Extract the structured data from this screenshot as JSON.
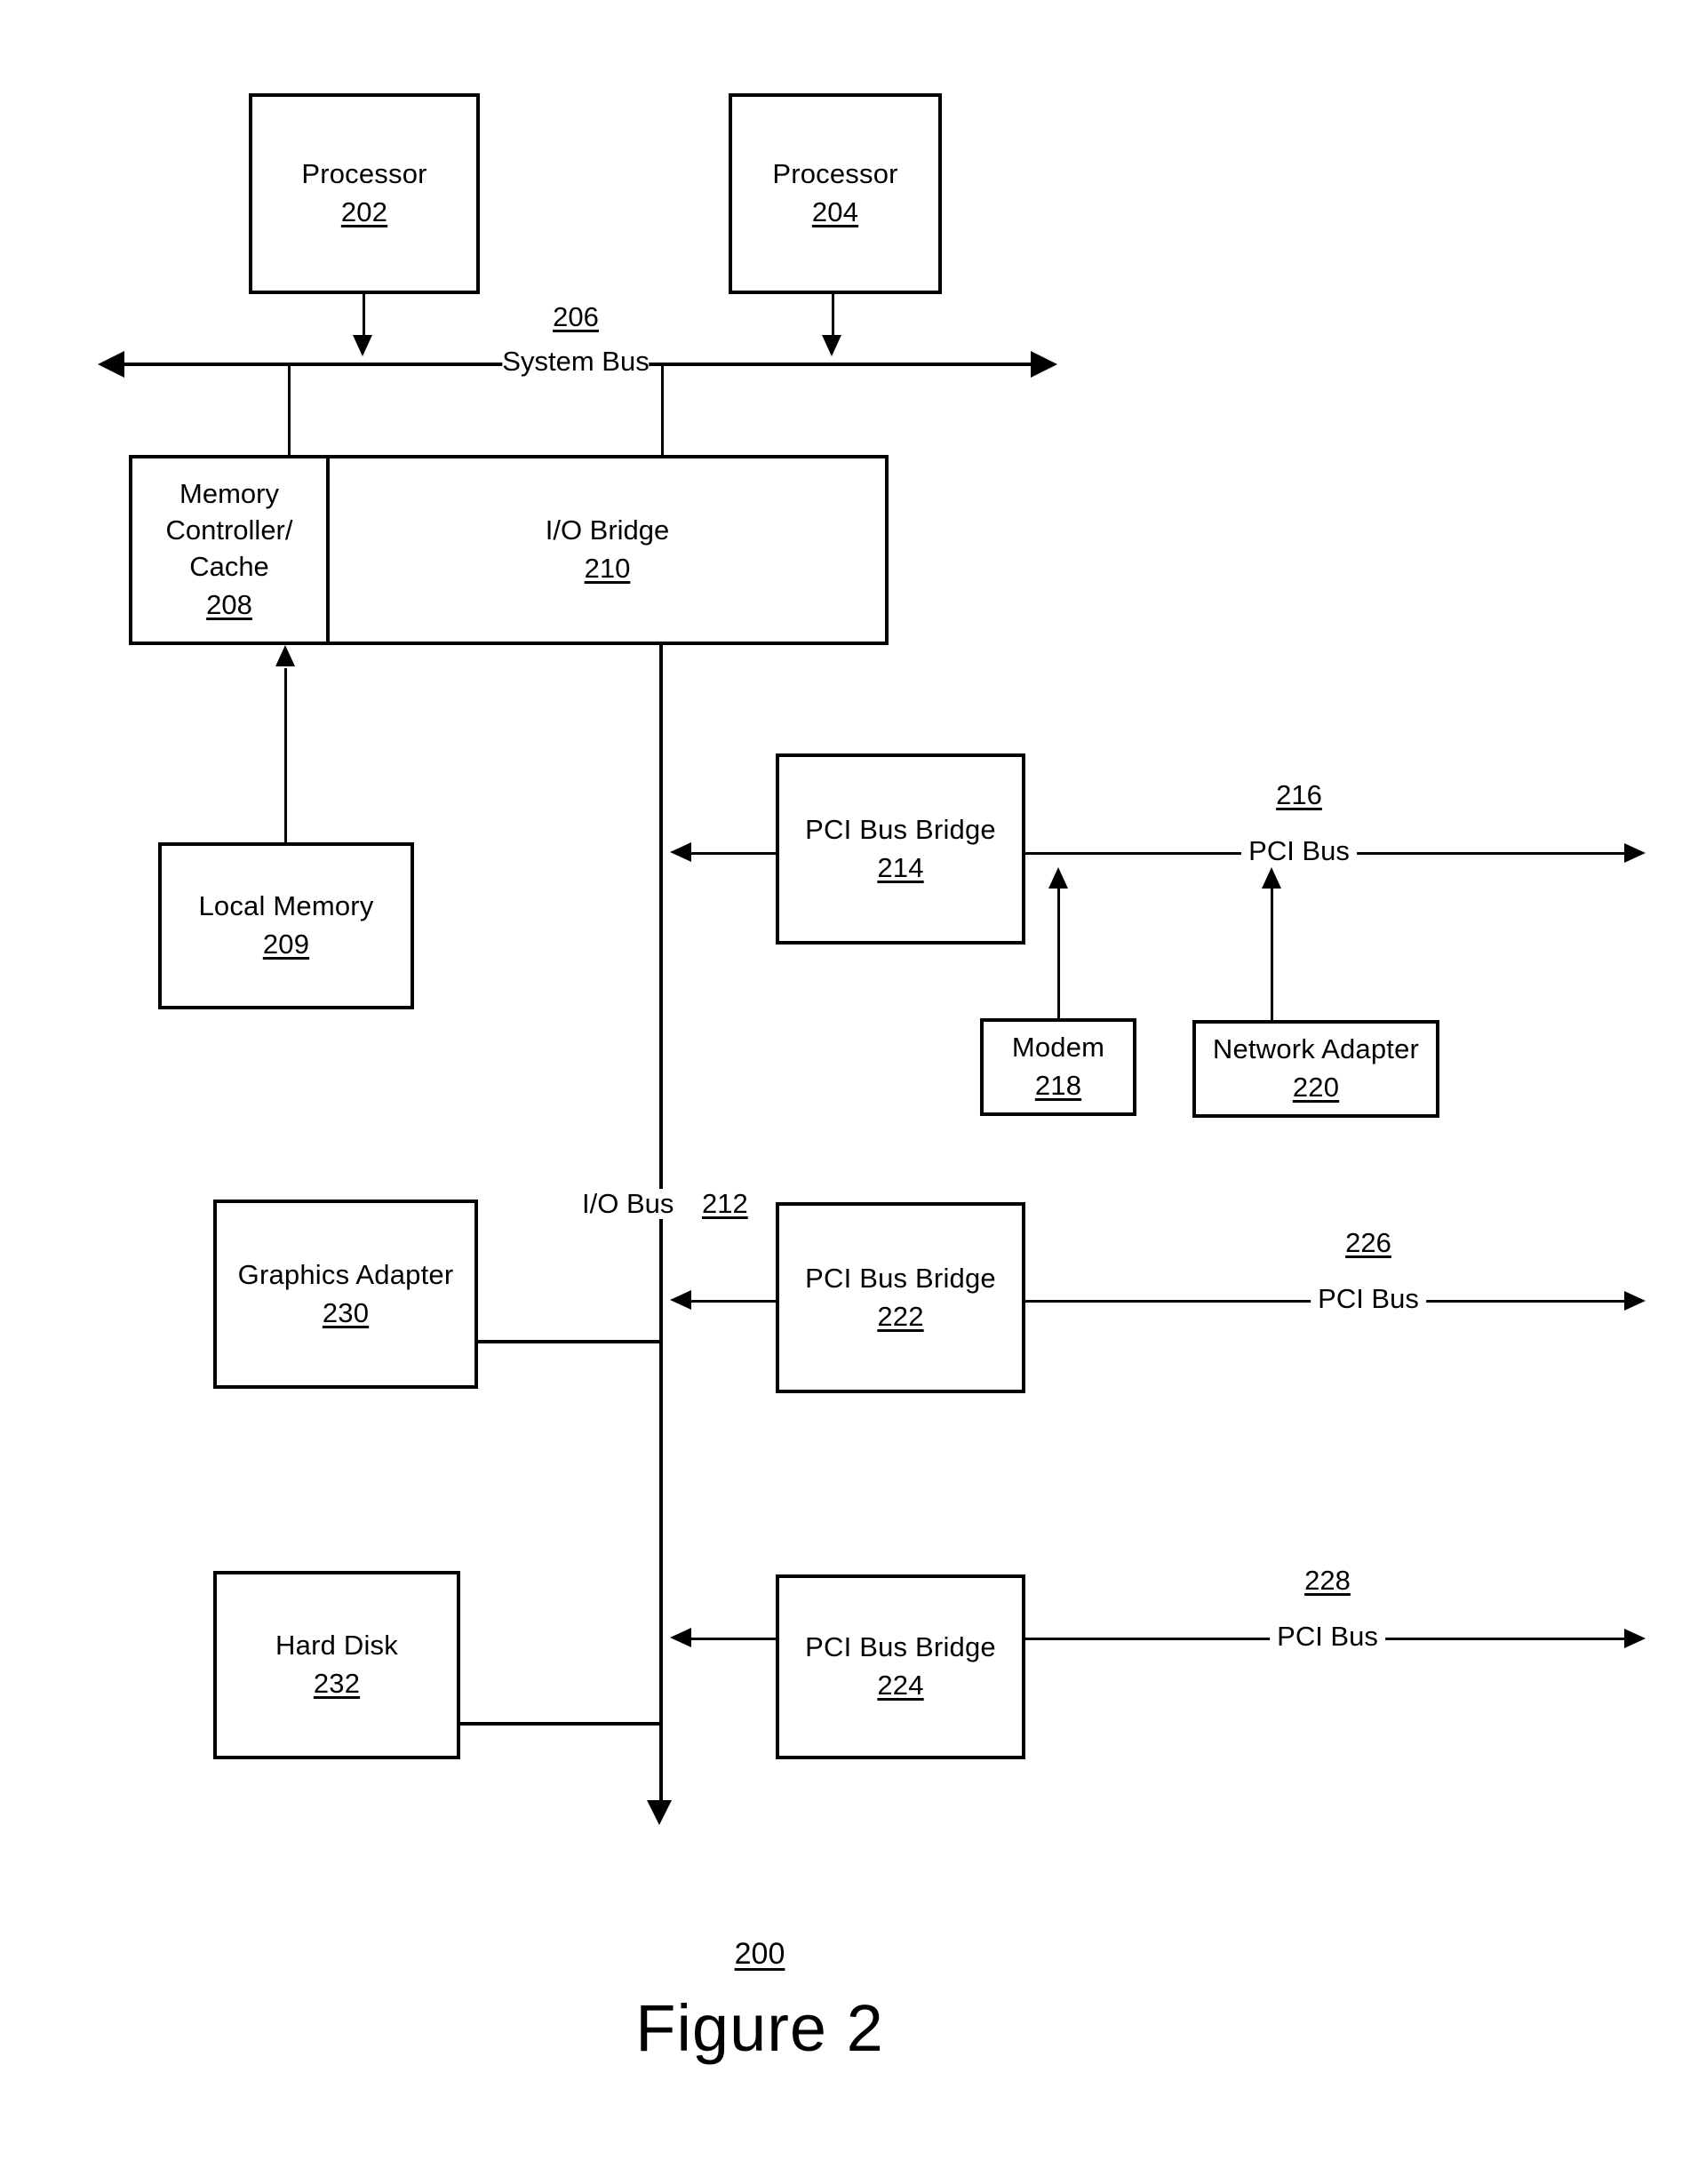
{
  "figure": {
    "number_ref": "200",
    "caption": "Figure 2"
  },
  "blocks": {
    "processor_1": {
      "title": "Processor",
      "ref": "202"
    },
    "processor_2": {
      "title": "Processor",
      "ref": "204"
    },
    "memory_controller": {
      "title": "Memory\nController/\nCache",
      "ref": "208"
    },
    "io_bridge": {
      "title": "I/O Bridge",
      "ref": "210"
    },
    "local_memory": {
      "title": "Local Memory",
      "ref": "209"
    },
    "pci_bus_bridge_214": {
      "title": "PCI Bus Bridge",
      "ref": "214"
    },
    "pci_bus_bridge_222": {
      "title": "PCI Bus Bridge",
      "ref": "222"
    },
    "pci_bus_bridge_224": {
      "title": "PCI Bus Bridge",
      "ref": "224"
    },
    "modem": {
      "title": "Modem",
      "ref": "218"
    },
    "network_adapter": {
      "title": "Network Adapter",
      "ref": "220"
    },
    "graphics_adapter": {
      "title": "Graphics Adapter",
      "ref": "230"
    },
    "hard_disk": {
      "title": "Hard Disk",
      "ref": "232"
    }
  },
  "buses": {
    "system_bus": {
      "ref": "206",
      "label": "System Bus"
    },
    "io_bus": {
      "label": "I/O Bus",
      "ref": "212"
    },
    "pci_bus_216": {
      "ref": "216",
      "label": "PCI Bus"
    },
    "pci_bus_226": {
      "ref": "226",
      "label": "PCI Bus"
    },
    "pci_bus_228": {
      "ref": "228",
      "label": "PCI Bus"
    }
  }
}
